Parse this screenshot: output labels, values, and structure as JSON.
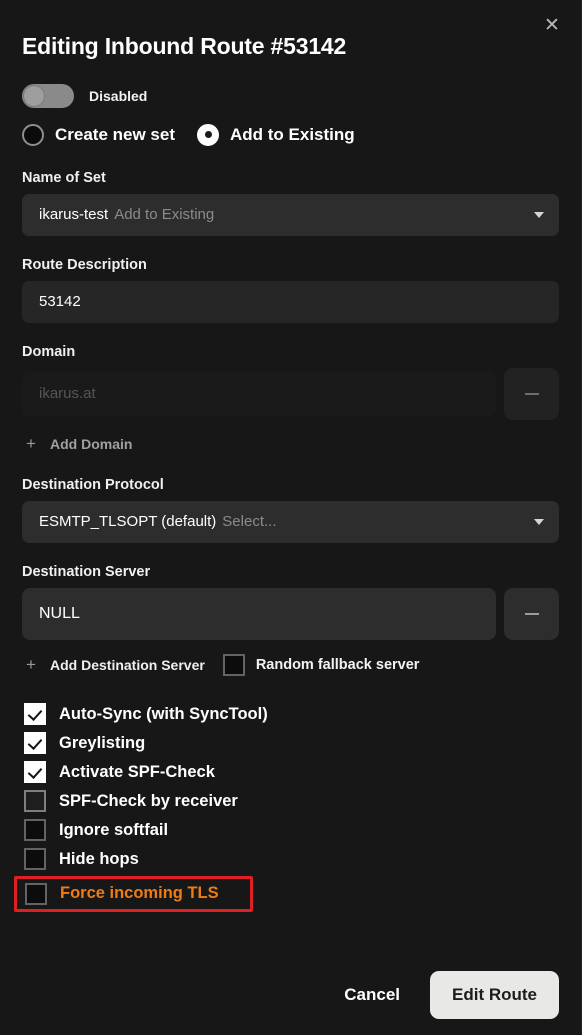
{
  "dialog": {
    "title": "Editing Inbound Route #53142",
    "close_icon": "close-icon"
  },
  "enable_toggle": {
    "label": "Disabled",
    "state": "off"
  },
  "set_mode": {
    "create_new": {
      "label": "Create new set",
      "selected": false
    },
    "add_existing": {
      "label": "Add to Existing",
      "selected": true
    }
  },
  "name_of_set": {
    "label": "Name of Set",
    "value": "ikarus-test",
    "placeholder": "Add to Existing",
    "caret_icon": "chevron-down-icon"
  },
  "route_description": {
    "label": "Route Description",
    "value": "53142",
    "placeholder": ""
  },
  "domain": {
    "label": "Domain",
    "value": "",
    "placeholder": "ikarus.at",
    "remove_icon": "minus-icon",
    "add_label": "Add Domain",
    "add_icon": "plus-icon"
  },
  "destination_protocol": {
    "label": "Destination Protocol",
    "value": "ESMTP_TLSOPT (default)",
    "placeholder": "Select...",
    "caret_icon": "chevron-down-icon"
  },
  "destination_server": {
    "label": "Destination Server",
    "value": "NULL",
    "remove_icon": "minus-icon",
    "add_label": "Add Destination Server",
    "add_icon": "plus-icon",
    "random_fallback": {
      "label": "Random fallback server",
      "checked": false
    }
  },
  "options": [
    {
      "label": "Auto-Sync (with SyncTool)",
      "checked": true,
      "highlighted": false
    },
    {
      "label": "Greylisting",
      "checked": true,
      "highlighted": false
    },
    {
      "label": "Activate SPF-Check",
      "checked": true,
      "highlighted": false
    },
    {
      "label": "SPF-Check by receiver",
      "checked": false,
      "highlighted": false
    },
    {
      "label": "Ignore softfail",
      "checked": false,
      "highlighted": false
    },
    {
      "label": "Hide hops",
      "checked": false,
      "highlighted": false
    },
    {
      "label": "Force incoming TLS",
      "checked": false,
      "highlighted": true
    }
  ],
  "footer": {
    "cancel_label": "Cancel",
    "submit_label": "Edit Route"
  },
  "colors": {
    "background": "#171717",
    "field": "#2d2d2d",
    "input": "#262626",
    "accent_highlight": "#e02020",
    "highlight_text": "#ef7b17",
    "primary_button": "#e8e8e6"
  }
}
